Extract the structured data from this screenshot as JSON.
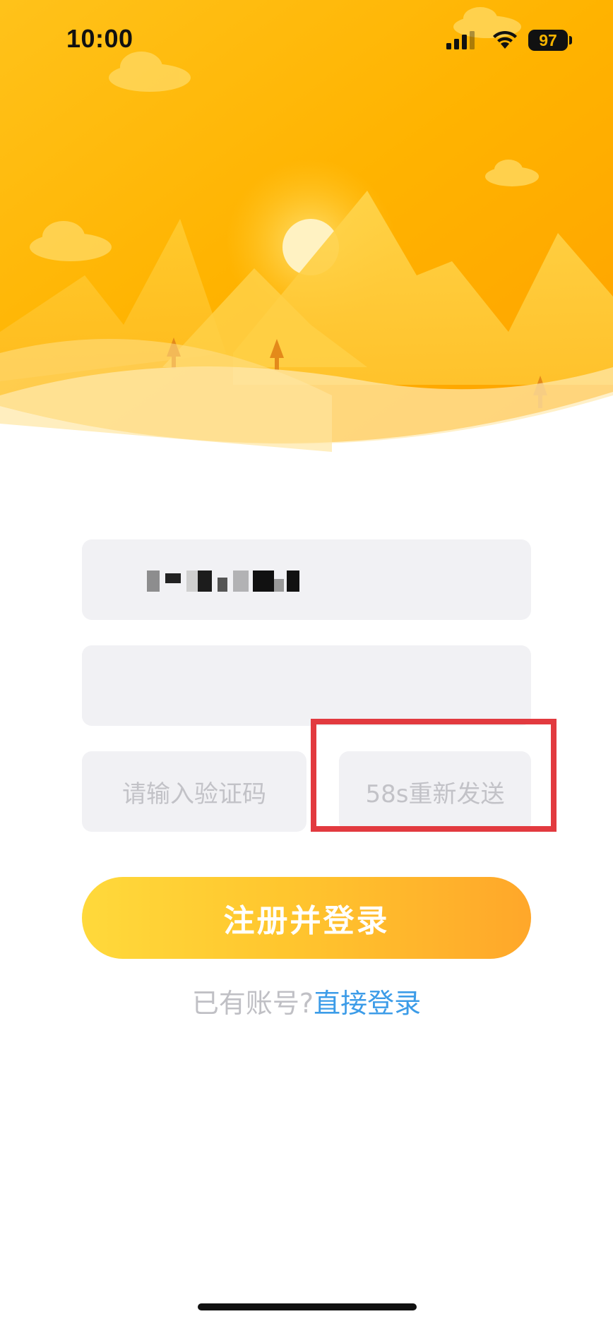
{
  "status_bar": {
    "time": "10:00",
    "battery": "97"
  },
  "form": {
    "phone_value": "",
    "password_value": "",
    "code_placeholder": "请输入验证码",
    "resend_label": "58s重新发送",
    "submit_label": "注册并登录"
  },
  "footer": {
    "have_account_text": "已有账号?",
    "login_link_text": "直接登录"
  },
  "colors": {
    "accent_orange": "#ffb100",
    "link_blue": "#3c9ce8",
    "highlight_red": "#e23a3f",
    "field_bg": "#f1f1f4"
  }
}
